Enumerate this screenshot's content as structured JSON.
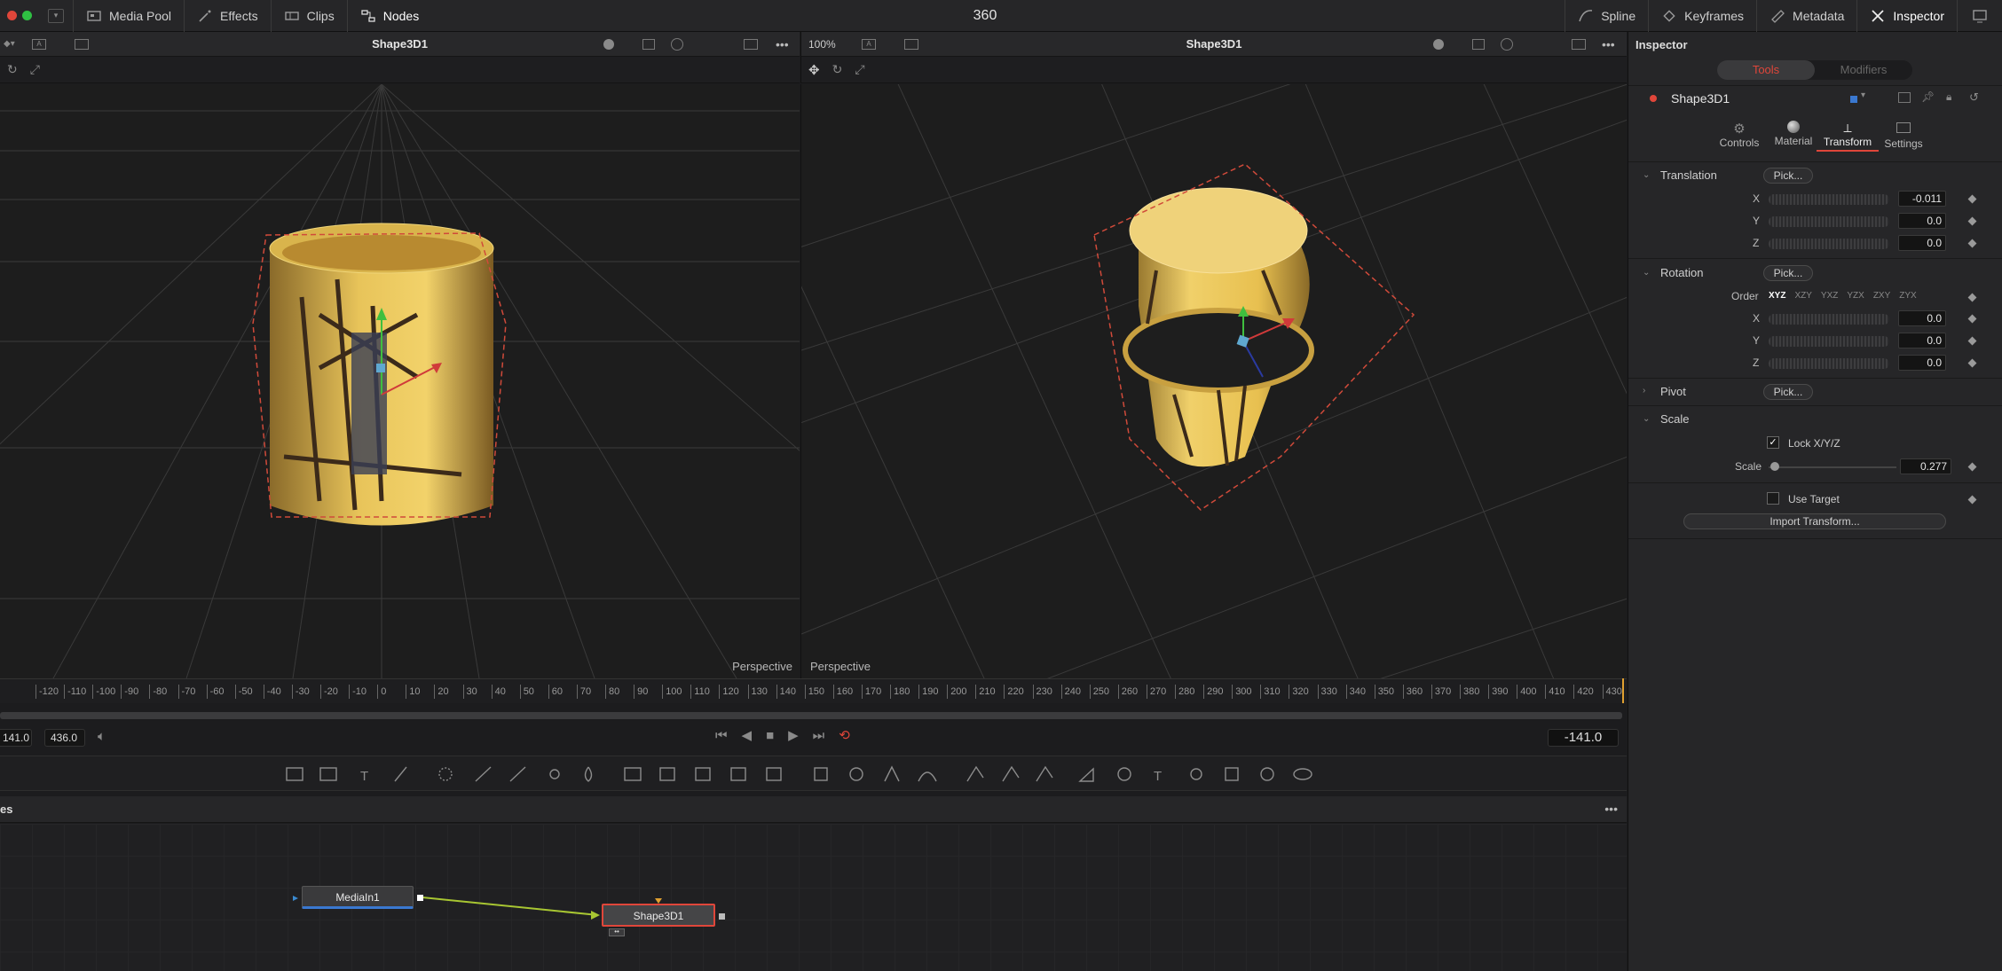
{
  "topbar": {
    "media_pool": "Media Pool",
    "effects": "Effects",
    "clips": "Clips",
    "nodes": "Nodes",
    "title": "360",
    "spline": "Spline",
    "keyframes": "Keyframes",
    "metadata": "Metadata",
    "inspector": "Inspector"
  },
  "viewer_left": {
    "title": "Shape3D1",
    "label": "Perspective"
  },
  "viewer_right": {
    "title": "Shape3D1",
    "label": "Perspective",
    "zoom": "100%"
  },
  "ruler": {
    "ticks": [
      "-120",
      "-110",
      "-100",
      "-90",
      "-80",
      "-70",
      "-60",
      "-50",
      "-40",
      "-30",
      "-20",
      "-10",
      "0",
      "10",
      "20",
      "30",
      "40",
      "50",
      "60",
      "70",
      "80",
      "90",
      "100",
      "110",
      "120",
      "130",
      "140",
      "150",
      "160",
      "170",
      "180",
      "190",
      "200",
      "210",
      "220",
      "230",
      "240",
      "250",
      "260",
      "270",
      "280",
      "290",
      "300",
      "310",
      "320",
      "330",
      "340",
      "350",
      "360",
      "370",
      "380",
      "390",
      "400",
      "410",
      "420",
      "430"
    ]
  },
  "transport": {
    "start": "141.0",
    "end": "436.0",
    "current": "-141.0"
  },
  "nodes": {
    "header": "es",
    "media_in": "MediaIn1",
    "shape": "Shape3D1"
  },
  "inspector": {
    "title": "Inspector",
    "tab_tools": "Tools",
    "tab_modifiers": "Modifiers",
    "node_name": "Shape3D1",
    "subtabs": {
      "controls": "Controls",
      "material": "Material",
      "transform": "Transform",
      "settings": "Settings"
    },
    "translation": {
      "label": "Translation",
      "pick": "Pick...",
      "x_label": "X",
      "x": "-0.011",
      "y_label": "Y",
      "y": "0.0",
      "z_label": "Z",
      "z": "0.0"
    },
    "rotation": {
      "label": "Rotation",
      "pick": "Pick...",
      "order_label": "Order",
      "orders": [
        "XYZ",
        "XZY",
        "YXZ",
        "YZX",
        "ZXY",
        "ZYX"
      ],
      "x_label": "X",
      "x": "0.0",
      "y_label": "Y",
      "y": "0.0",
      "z_label": "Z",
      "z": "0.0"
    },
    "pivot": {
      "label": "Pivot",
      "pick": "Pick..."
    },
    "scale": {
      "label": "Scale",
      "lock": "Lock X/Y/Z",
      "scale_label": "Scale",
      "value": "0.277"
    },
    "use_target": "Use Target",
    "import_transform": "Import Transform..."
  },
  "colors": {
    "accent_red": "#e0463a",
    "node_line": "#a8c632",
    "inspector_highlight": "#3a78d0"
  }
}
